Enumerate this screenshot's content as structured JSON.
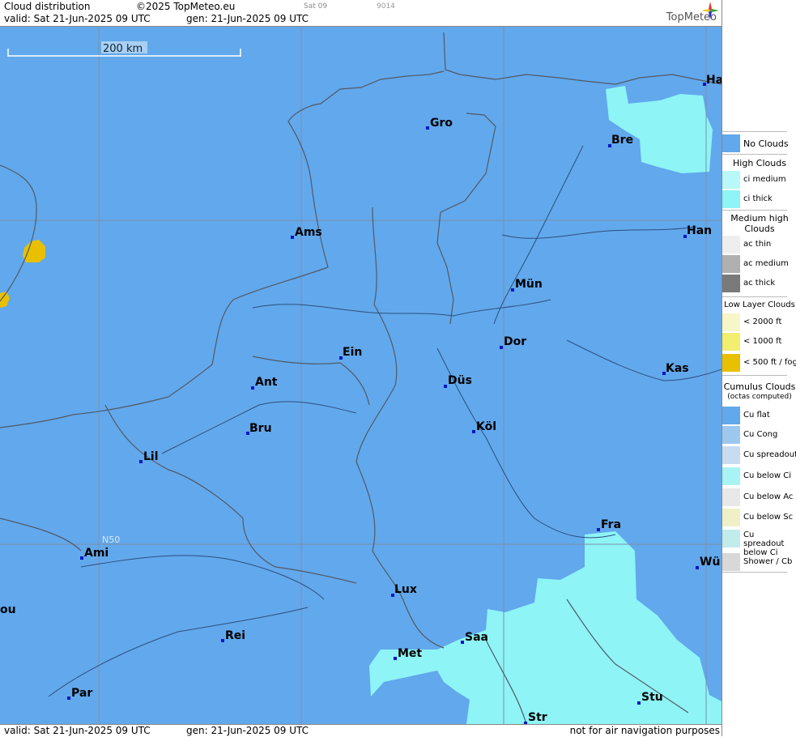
{
  "header": {
    "title": "Cloud distribution",
    "copyright": "©2025 TopMeteo.eu",
    "small_tag1": "Sat 09",
    "small_tag2": "9014",
    "valid": "valid:  Sat  21-Jun-2025  09 UTC",
    "gen": "gen: 21-Jun-2025 09 UTC",
    "logo": "TopMeteo"
  },
  "footer": {
    "valid": "valid:  Sat  21-Jun-2025  09 UTC",
    "gen": "gen: 21-Jun-2025 09 UTC",
    "note": "not for air navigation purposes"
  },
  "map": {
    "scale_label": "200 km",
    "lat_label": "N50",
    "cities": [
      {
        "name": "Ha"
      },
      {
        "name": "Gro"
      },
      {
        "name": "Bre"
      },
      {
        "name": "Ams"
      },
      {
        "name": "Han"
      },
      {
        "name": "Mün"
      },
      {
        "name": "Ein"
      },
      {
        "name": "Dor"
      },
      {
        "name": "Ant"
      },
      {
        "name": "Düs"
      },
      {
        "name": "Kas"
      },
      {
        "name": "Bru"
      },
      {
        "name": "Köl"
      },
      {
        "name": "Lil"
      },
      {
        "name": "Fra"
      },
      {
        "name": "Ami"
      },
      {
        "name": "Wü"
      },
      {
        "name": "Lux"
      },
      {
        "name": "ou"
      },
      {
        "name": "Rei"
      },
      {
        "name": "Saa"
      },
      {
        "name": "Met"
      },
      {
        "name": "Stu"
      },
      {
        "name": "Par"
      },
      {
        "name": "Str"
      }
    ]
  },
  "legend": {
    "no_clouds": "No Clouds",
    "high_title": "High Clouds",
    "high": [
      "ci medium",
      "ci thick"
    ],
    "medium_title": "Medium high Clouds",
    "medium": [
      "ac thin",
      "ac medium",
      "ac thick"
    ],
    "low_title": "Low Layer Clouds",
    "low": [
      "< 2000 ft",
      "< 1000 ft",
      "< 500 ft / fog"
    ],
    "cumulus_title": "Cumulus Clouds",
    "cumulus_sub": "(octas computed)",
    "cumulus": [
      "Cu flat",
      "Cu Cong",
      "Cu spreadout",
      "Cu below Ci",
      "Cu below Ac",
      "Cu below Sc",
      "Cu spreadout below Ci",
      "Shower / Cb"
    ],
    "colors": {
      "no_clouds": "#62a8ec",
      "ci": "#8ef4f6",
      "fog": "#e8c000"
    }
  }
}
